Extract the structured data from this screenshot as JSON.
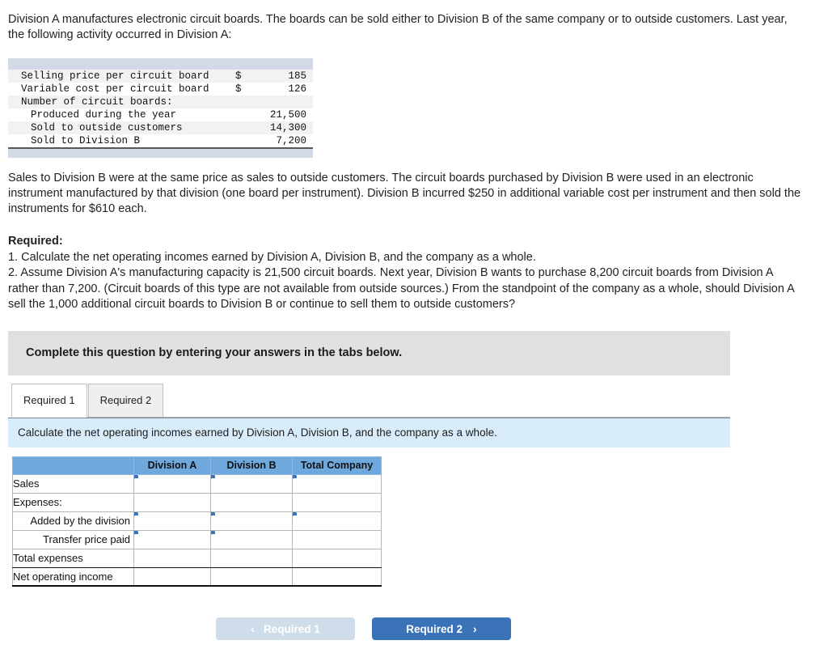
{
  "intro": {
    "paragraph": "Division A manufactures electronic circuit boards. The boards can be sold either to Division B of the same company or to outside customers. Last year, the following activity occurred in Division A:"
  },
  "fact_table": {
    "rows": [
      {
        "label": "Selling price per circuit board",
        "currency": "$",
        "value": "185",
        "indent": false
      },
      {
        "label": "Variable cost per circuit board",
        "currency": "$",
        "value": "126",
        "indent": false
      },
      {
        "label": "Number of circuit boards:",
        "currency": "",
        "value": "",
        "indent": false
      },
      {
        "label": "Produced during the year",
        "currency": "",
        "value": "21,500",
        "indent": true
      },
      {
        "label": "Sold to outside customers",
        "currency": "",
        "value": "14,300",
        "indent": true
      },
      {
        "label": "Sold to Division B",
        "currency": "",
        "value": "7,200",
        "indent": true
      }
    ]
  },
  "body": {
    "paragraph": "Sales to Division B were at the same price as sales to outside customers. The circuit boards purchased by Division B were used in an electronic instrument manufactured by that division (one board per instrument). Division B incurred $250 in additional variable cost per instrument and then sold the instruments for $610 each."
  },
  "required": {
    "heading": "Required:",
    "item1": "1. Calculate the net operating incomes earned by Division A, Division B, and the company as a whole.",
    "item2": "2. Assume Division A's manufacturing capacity is 21,500 circuit boards. Next year, Division B wants to purchase 8,200 circuit boards from Division A rather than 7,200. (Circuit boards of this type are not available from outside sources.) From the standpoint of the company as a whole, should Division A sell the 1,000 additional circuit boards to Division B or continue to sell them to outside customers?"
  },
  "banner": {
    "text": "Complete this question by entering your answers in the tabs below."
  },
  "tabs": [
    {
      "label": "Required 1",
      "active": true
    },
    {
      "label": "Required 2",
      "active": false
    }
  ],
  "prompt": {
    "text": "Calculate the net operating incomes earned by Division A, Division B, and the company as a whole."
  },
  "answer_table": {
    "corner_label": "",
    "columns": [
      "Division A",
      "Division B",
      "Total Company"
    ],
    "rows": [
      {
        "label": "Sales",
        "indent": false,
        "cells": [
          "input",
          "input",
          "input"
        ],
        "emphasis": "none"
      },
      {
        "label": "Expenses:",
        "indent": false,
        "cells": [
          "plain",
          "plain",
          "plain"
        ],
        "emphasis": "none"
      },
      {
        "label": "Added by the division",
        "indent": true,
        "cells": [
          "input",
          "input",
          "input"
        ],
        "emphasis": "none"
      },
      {
        "label": "Transfer price paid",
        "indent": true,
        "cells": [
          "input",
          "input",
          "plain"
        ],
        "emphasis": "none"
      },
      {
        "label": "Total expenses",
        "indent": false,
        "cells": [
          "plain",
          "plain",
          "plain"
        ],
        "emphasis": "strong"
      },
      {
        "label": "Net operating income",
        "indent": false,
        "cells": [
          "plain",
          "plain",
          "plain"
        ],
        "emphasis": "last"
      }
    ]
  },
  "nav": {
    "prev_label": "Required 1",
    "prev_chevron": "‹",
    "next_label": "Required 2",
    "next_chevron": "›"
  },
  "colors": {
    "accent_blue": "#3a73b8",
    "header_blue": "#6fa8dc",
    "prompt_blue": "#d9ecfa",
    "banner_gray": "#e0e0e0",
    "fact_bar": "#d3d9e6"
  }
}
